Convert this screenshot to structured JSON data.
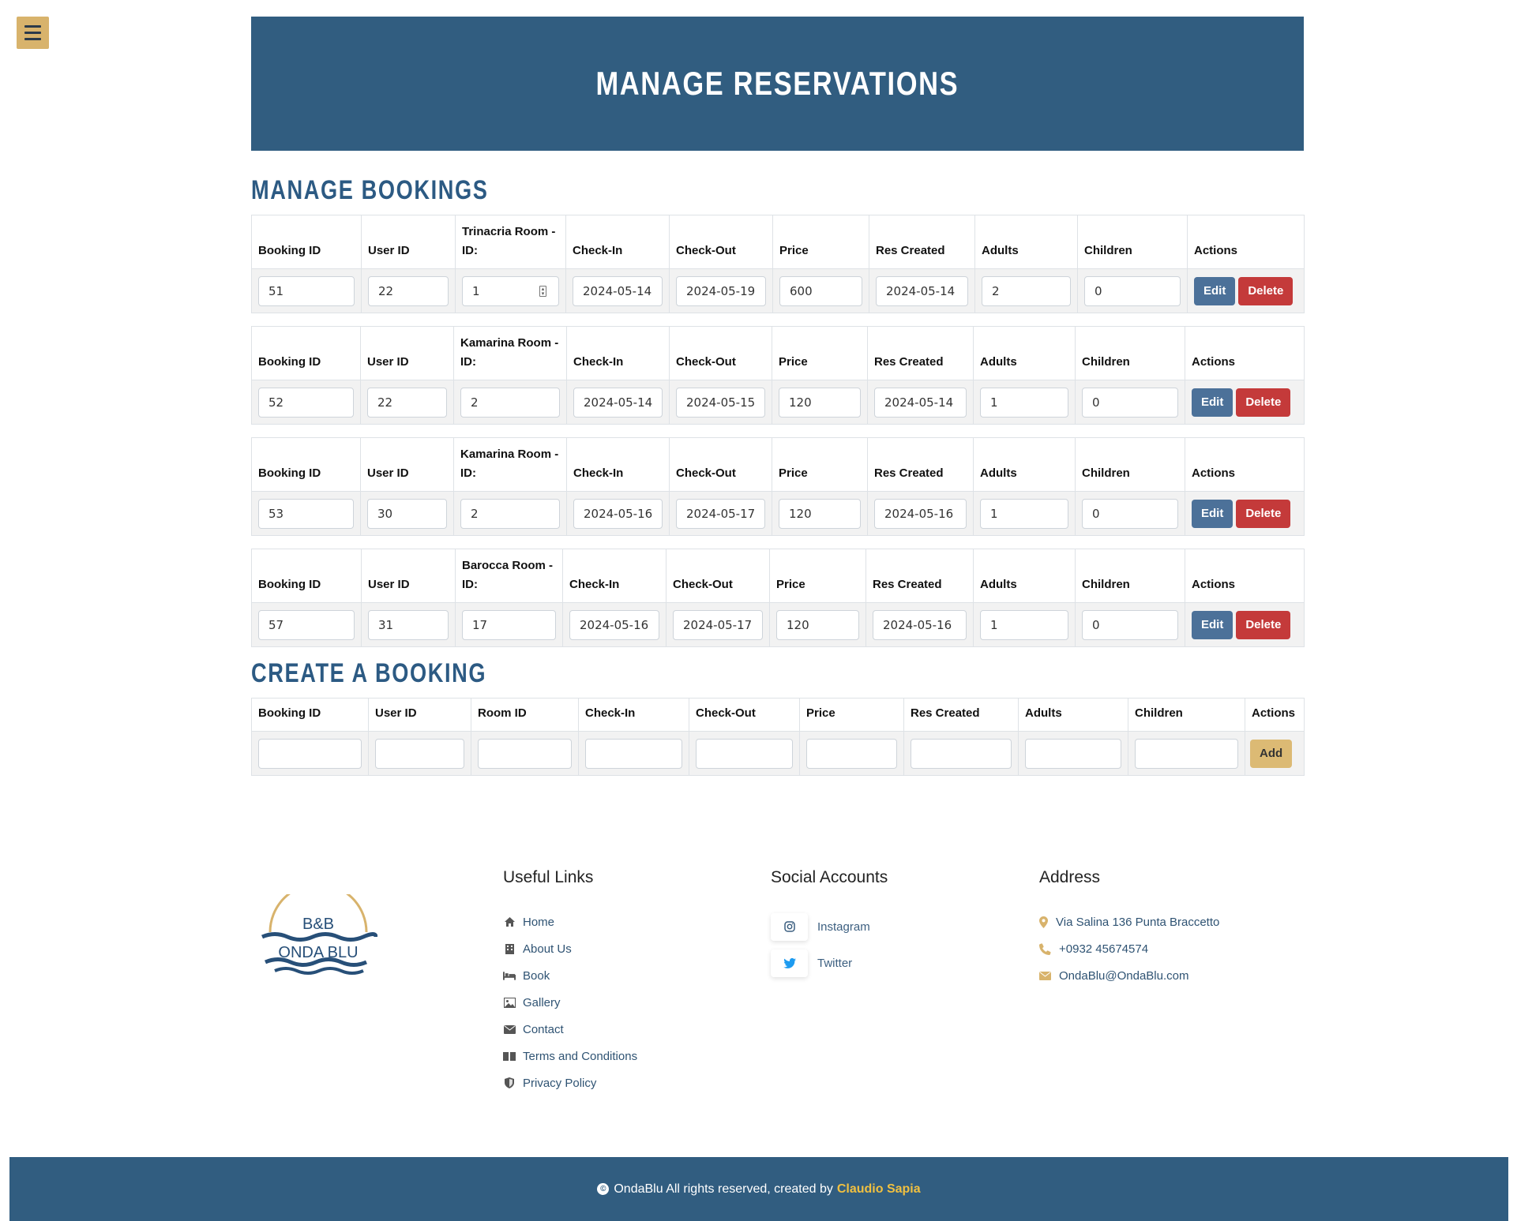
{
  "hero": {
    "title": "MANAGE RESERVATIONS"
  },
  "manage": {
    "title": "MANAGE BOOKINGS"
  },
  "bookings": [
    {
      "headers": [
        "Booking ID",
        "User ID",
        "Trinacria Room - ID:",
        "Check-In",
        "Check-Out",
        "Price",
        "Res Created",
        "Adults",
        "Children",
        "Actions"
      ],
      "values": [
        "51",
        "22",
        "1",
        "2024-05-14",
        "2024-05-19",
        "600",
        "2024-05-14 1",
        "2",
        "0"
      ]
    },
    {
      "headers": [
        "Booking ID",
        "User ID",
        "Kamarina Room - ID:",
        "Check-In",
        "Check-Out",
        "Price",
        "Res Created",
        "Adults",
        "Children",
        "Actions"
      ],
      "values": [
        "52",
        "22",
        "2",
        "2024-05-14",
        "2024-05-15",
        "120",
        "2024-05-14",
        "1",
        "0"
      ]
    },
    {
      "headers": [
        "Booking ID",
        "User ID",
        "Kamarina Room - ID:",
        "Check-In",
        "Check-Out",
        "Price",
        "Res Created",
        "Adults",
        "Children",
        "Actions"
      ],
      "values": [
        "53",
        "30",
        "2",
        "2024-05-16",
        "2024-05-17",
        "120",
        "2024-05-16 (",
        "1",
        "0"
      ]
    },
    {
      "headers": [
        "Booking ID",
        "User ID",
        "Barocca Room - ID:",
        "Check-In",
        "Check-Out",
        "Price",
        "Res Created",
        "Adults",
        "Children",
        "Actions"
      ],
      "values": [
        "57",
        "31",
        "17",
        "2024-05-16",
        "2024-05-17",
        "120",
        "2024-05-16 (",
        "1",
        "0"
      ]
    }
  ],
  "buttons": {
    "edit": "Edit",
    "delete": "Delete",
    "add": "Add"
  },
  "create": {
    "title": "CREATE A BOOKING",
    "headers": [
      "Booking ID",
      "User ID",
      "Room ID",
      "Check-In",
      "Check-Out",
      "Price",
      "Res Created",
      "Adults",
      "Children",
      "Actions"
    ]
  },
  "footer": {
    "logo": {
      "line1": "B&B",
      "line2": "ONDA BLU"
    },
    "useful_links": {
      "title": "Useful Links",
      "items": [
        {
          "label": "Home",
          "icon": "home-icon"
        },
        {
          "label": "About Us",
          "icon": "building-icon"
        },
        {
          "label": "Book",
          "icon": "bed-icon"
        },
        {
          "label": "Gallery",
          "icon": "image-icon"
        },
        {
          "label": "Contact",
          "icon": "envelope-icon"
        },
        {
          "label": "Terms and Conditions",
          "icon": "book-icon"
        },
        {
          "label": "Privacy Policy",
          "icon": "shield-icon"
        }
      ]
    },
    "social": {
      "title": "Social Accounts",
      "items": [
        {
          "label": "Instagram",
          "icon": "instagram-icon"
        },
        {
          "label": "Twitter",
          "icon": "twitter-icon"
        }
      ]
    },
    "address": {
      "title": "Address",
      "street": "Via Salina 136 Punta Braccetto",
      "phone": "+0932 45674574",
      "email": "OndaBlu@OndaBlu.com"
    },
    "copyright": {
      "text": "OndaBlu All rights reserved, created by",
      "author": "Claudio Sapia"
    }
  },
  "colors": {
    "primary": "#315d80",
    "heading": "#2c5a83",
    "accent": "#d8b36c",
    "edit": "#4c7199",
    "delete": "#c43a3a",
    "author": "#f0c040"
  }
}
